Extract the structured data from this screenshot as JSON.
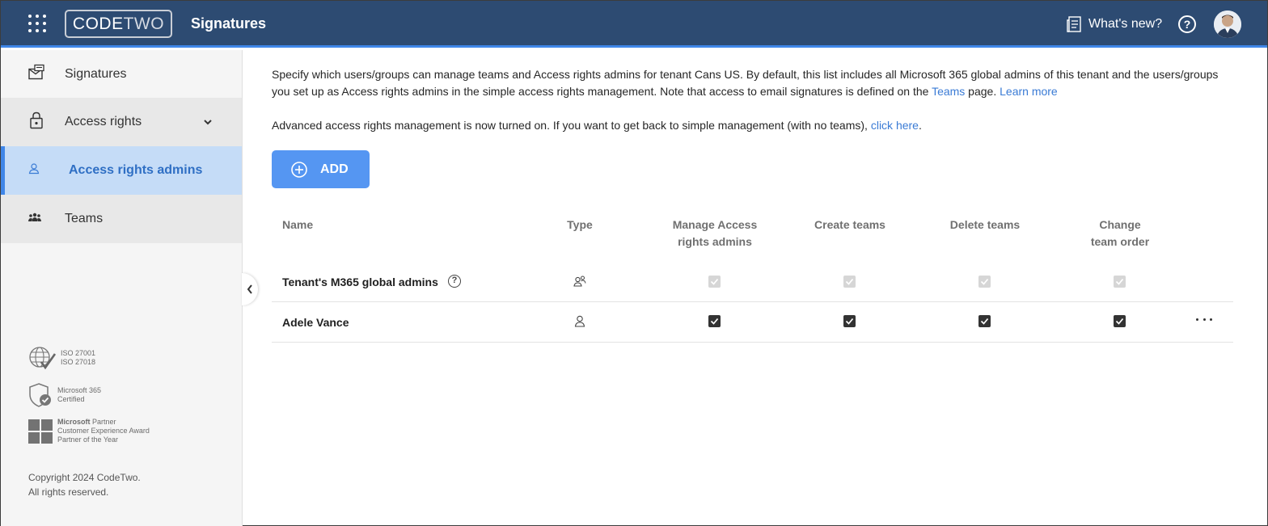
{
  "header": {
    "logo_part1": "CODE",
    "logo_part2": "TWO",
    "app_title": "Signatures",
    "whats_new": "What's new?",
    "help_glyph": "?",
    "accent_color": "#3f86e8",
    "bar_color": "#2d4b72"
  },
  "sidebar": {
    "items": [
      {
        "label": "Signatures",
        "icon": "signature-icon"
      },
      {
        "label": "Access rights",
        "icon": "lock-icon"
      },
      {
        "label": "Access rights admins",
        "icon": "person-icon",
        "active": true
      },
      {
        "label": "Teams",
        "icon": "team-icon"
      }
    ],
    "badges": {
      "iso_line1": "ISO 27001",
      "iso_line2": "ISO 27018",
      "ms365_line1": "Microsoft 365",
      "ms365_line2": "Certified",
      "partner_brand": "Microsoft",
      "partner_word": "Partner",
      "partner_line2": "Customer Experience Award",
      "partner_line3": "Partner of the Year"
    },
    "copyright_line1": "Copyright 2024 CodeTwo.",
    "copyright_line2": "All rights reserved."
  },
  "main": {
    "intro_text": "Specify which users/groups can manage teams and Access rights admins for tenant Cans US. By default, this list includes all Microsoft 365 global admins of this tenant and the users/groups you set up as Access rights admins in the simple access rights management. Note that access to email signatures is defined on the ",
    "teams_link": "Teams",
    "intro_after_link": " page. ",
    "learn_more": "Learn more",
    "advanced_text": "Advanced access rights management is now turned on. If you want to get back to simple management (with no teams), ",
    "click_here": "click here",
    "period": ".",
    "add_button": "ADD",
    "columns": {
      "name": "Name",
      "type": "Type",
      "manage_1": "Manage Access",
      "manage_2": "rights admins",
      "create": "Create teams",
      "delete": "Delete teams",
      "change_1": "Change",
      "change_2": "team order"
    },
    "rows": [
      {
        "name": "Tenant's M365 global admins",
        "type_icon": "group-icon",
        "manage": true,
        "create": true,
        "delete": true,
        "change": true,
        "disabled": true
      },
      {
        "name": "Adele Vance",
        "type_icon": "user-icon",
        "manage": true,
        "create": true,
        "delete": true,
        "change": true,
        "disabled": false
      }
    ]
  }
}
